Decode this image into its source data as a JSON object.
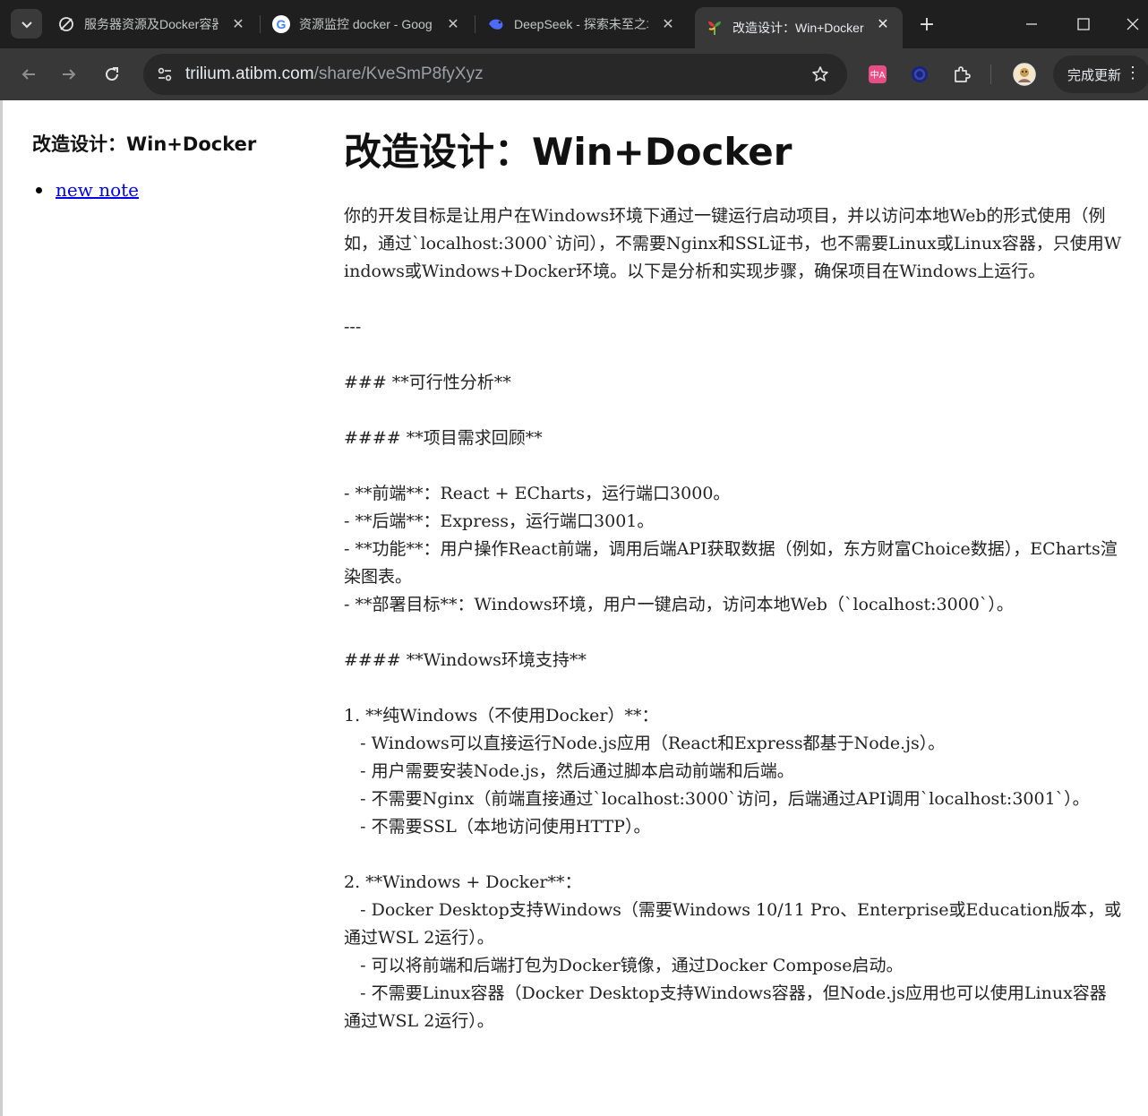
{
  "browser": {
    "tabs": [
      {
        "title": "服务器资源及Docker容器",
        "icon": "trilium-icon",
        "active": false
      },
      {
        "title": "资源监控 docker - Goog",
        "icon": "google-icon",
        "active": false
      },
      {
        "title": "DeepSeek - 探索未至之境",
        "icon": "deepseek-icon",
        "active": false
      },
      {
        "title": "改造设计：Win+Docker",
        "icon": "trilium-icon",
        "active": true
      }
    ],
    "url_host": "trilium.atibm.com",
    "url_path": "/share/KveSmP8fyXyz",
    "update_label": "完成更新"
  },
  "sidebar": {
    "title": "改造设计：Win+Docker",
    "items": [
      {
        "label": "new note"
      }
    ]
  },
  "note": {
    "title": "改造设计：Win+Docker",
    "body": "你的开发目标是让用户在Windows环境下通过一键运行启动项目，并以访问本地Web的形式使用（例如，通过`localhost:3000`访问），不需要Nginx和SSL证书，也不需要Linux或Linux容器，只使用Windows或Windows+Docker环境。以下是分析和实现步骤，确保项目在Windows上运行。\n\n---\n\n### **可行性分析**\n\n#### **项目需求回顾**\n\n- **前端**：React + ECharts，运行端口3000。\n- **后端**：Express，运行端口3001。\n- **功能**：用户操作React前端，调用后端API获取数据（例如，东方财富Choice数据），ECharts渲染图表。\n- **部署目标**：Windows环境，用户一键启动，访问本地Web（`localhost:3000`）。\n\n#### **Windows环境支持**\n\n1. **纯Windows（不使用Docker）**：\n   - Windows可以直接运行Node.js应用（React和Express都基于Node.js）。\n   - 用户需要安装Node.js，然后通过脚本启动前端和后端。\n   - 不需要Nginx（前端直接通过`localhost:3000`访问，后端通过API调用`localhost:3001`）。\n   - 不需要SSL（本地访问使用HTTP）。\n\n2. **Windows + Docker**：\n   - Docker Desktop支持Windows（需要Windows 10/11 Pro、Enterprise或Education版本，或通过WSL 2运行）。\n   - 可以将前端和后端打包为Docker镜像，通过Docker Compose启动。\n   - 不需要Linux容器（Docker Desktop支持Windows容器，但Node.js应用也可以使用Linux容器通过WSL 2运行）。"
  }
}
